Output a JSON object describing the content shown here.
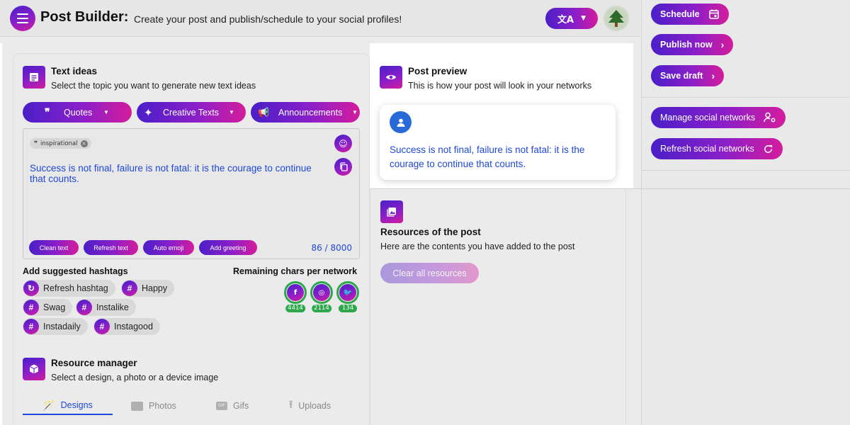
{
  "header": {
    "title": "Post Builder:",
    "subtitle": "Create your post and publish/schedule to your social profiles!",
    "lang_glyph": "文A"
  },
  "sidebar": {
    "schedule_label": "Schedule",
    "publish_label": "Publish now",
    "save_label": "Save draft",
    "manage_label": "Manage social networks",
    "refresh_label": "Refresh social networks"
  },
  "text_ideas": {
    "title": "Text ideas",
    "subtitle": "Select the topic you want to generate new text ideas",
    "quotes_label": "Quotes",
    "creative_label": "Creative Texts",
    "announcements_label": "Announcements"
  },
  "editor": {
    "tag_label": "inspirational",
    "post_text": "Success is not final, failure is not fatal: it is the courage to continue that counts.",
    "clean_label": "Clean text",
    "refresh_label": "Refresh text",
    "emoji_label": "Auto emoji",
    "greeting_label": "Add greeting",
    "char_count": "86 / 8000"
  },
  "hashtags": {
    "title": "Add suggested hashtags",
    "refresh_label": "Refresh hashtag",
    "tags": [
      "Happy",
      "Swag",
      "Instalike",
      "Instadaily",
      "Instagood"
    ]
  },
  "remaining": {
    "title": "Remaining chars per network",
    "facebook": "4414",
    "instagram": "2114",
    "twitter": "134"
  },
  "resource_manager": {
    "title": "Resource manager",
    "subtitle": "Select a design, a photo or a device image",
    "tabs": [
      "Designs",
      "Photos",
      "Gifs",
      "Uploads"
    ]
  },
  "preview": {
    "title": "Post preview",
    "subtitle": "This is how your post will look in your networks",
    "text": "Success is not final, failure is not fatal: it is the courage to continue that counts."
  },
  "resources": {
    "title": "Resources of the post",
    "subtitle": "Here are the contents you have added to the post",
    "clear_label": "Clear all resources"
  },
  "colors": {
    "accent_start": "#4a1fc8",
    "accent_end": "#d41c9c",
    "text_blue": "#1f47d8",
    "green": "#2aa84a"
  }
}
